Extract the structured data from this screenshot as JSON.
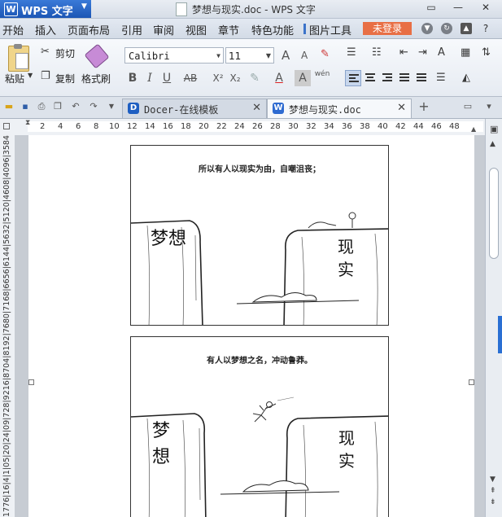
{
  "app": {
    "name": "WPS 文字",
    "logo": "W",
    "window_title": "梦想与现实.doc - WPS 文字"
  },
  "menu": {
    "items": [
      "开始",
      "插入",
      "页面布局",
      "引用",
      "审阅",
      "视图",
      "章节",
      "特色功能",
      "图片工具"
    ],
    "active": "开始",
    "login_label": "未登录"
  },
  "ribbon": {
    "paste_label": "粘贴",
    "cut_label": "剪切",
    "copy_label": "复制",
    "format_painter_label": "格式刷",
    "font_name": "Calibri",
    "font_size": "11",
    "bold": "B",
    "italic": "I",
    "underline": "U",
    "strikethrough": "AB",
    "superscript": "X²",
    "subscript": "X₂",
    "phonetic_label": "wén",
    "grow_font": "A",
    "shrink_font": "A"
  },
  "tabs": [
    {
      "title": "Docer-在线模板",
      "icon": "D",
      "icon_color": "#1e5fc2"
    },
    {
      "title": "梦想与现实.doc",
      "icon": "W",
      "icon_color": "#2e6bd1"
    }
  ],
  "ruler": {
    "marks": [
      "2",
      "4",
      "6",
      "8",
      "10",
      "12",
      "14",
      "16",
      "18",
      "20",
      "22",
      "24",
      "26",
      "28",
      "30",
      "32",
      "34",
      "36",
      "38",
      "40",
      "42",
      "44",
      "46",
      "48"
    ],
    "vertical_text": "1776|16|4|1|05|20|24|09|728|9216|8704|8192|7680|7168|6656|6144|5632|5120|4608|4096|3584|3072|2560|2048"
  },
  "document": {
    "panel1_caption": "所以有人以现实为由，自嘲沮丧；",
    "panel2_caption": "有人以梦想之名，冲动鲁莽。",
    "dream_label": "梦想",
    "reality_label": "现实"
  },
  "colors": {
    "accent": "#2a6fd3",
    "login": "#e86f45",
    "wps_blue": "#1c56b5"
  }
}
